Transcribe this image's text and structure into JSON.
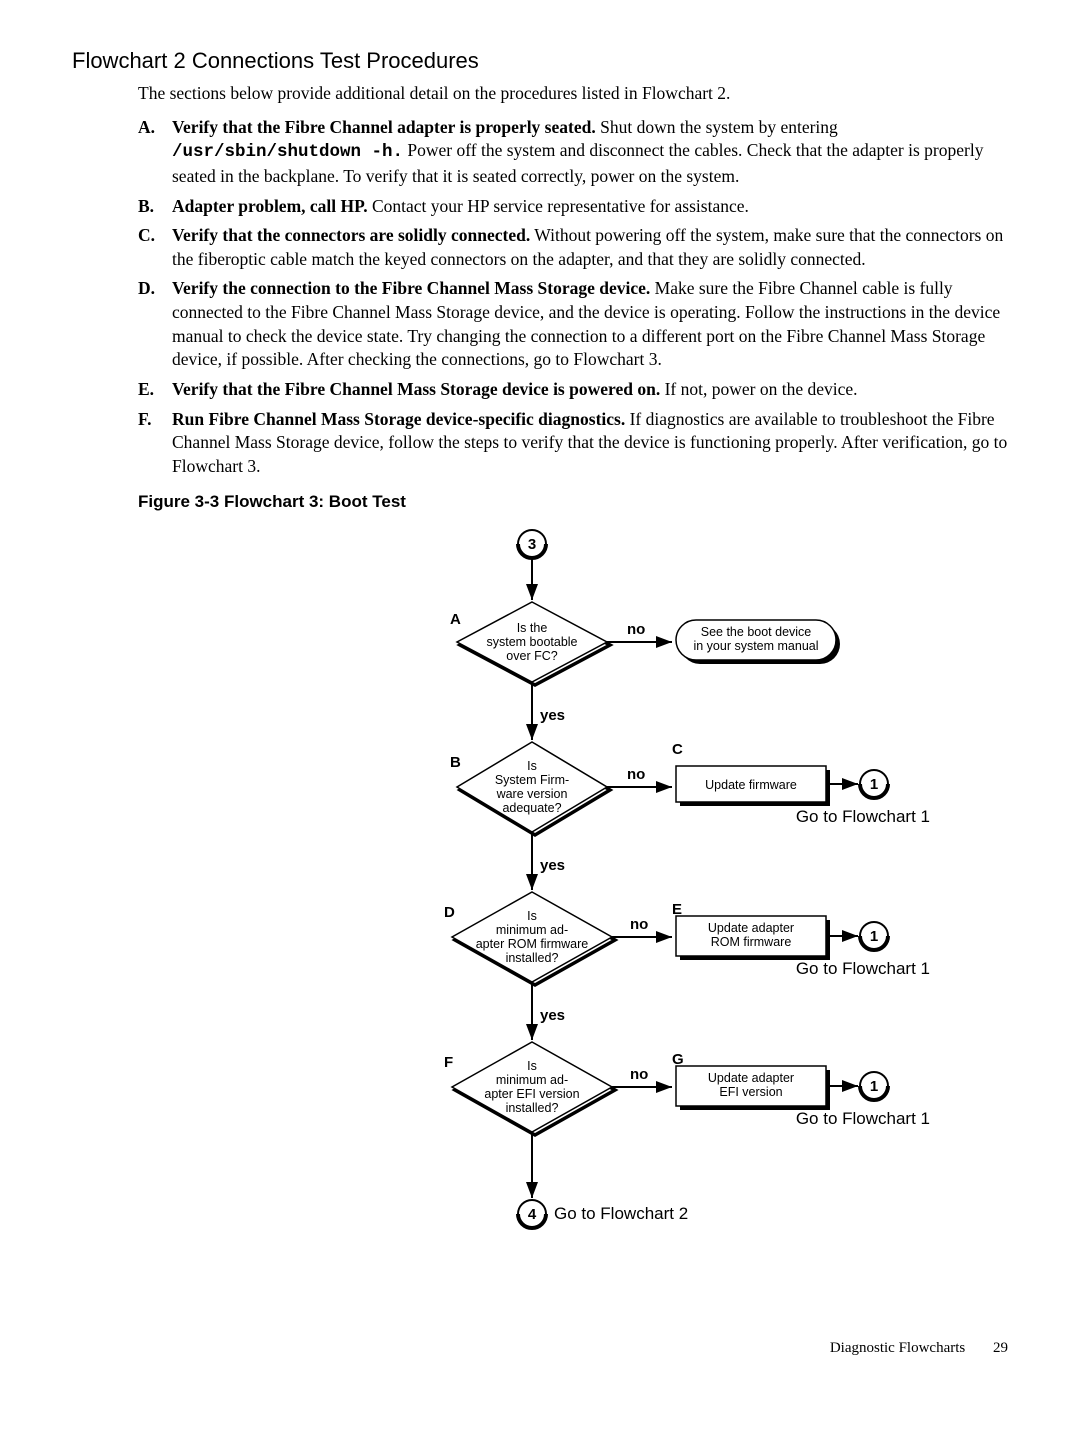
{
  "section_title": "Flowchart 2 Connections Test Procedures",
  "intro": "The sections below provide additional detail on the procedures listed in Flowchart 2.",
  "items": {
    "A": {
      "m": "A.",
      "bold": "Verify that the Fibre Channel adapter is properly seated.",
      "t1": " Shut down the system by entering ",
      "mono": "/usr/sbin/shutdown -h.",
      "t2": " Power off the system and disconnect the cables. Check that the adapter is properly seated in the backplane. To verify that it is seated correctly, power on the system."
    },
    "B": {
      "m": "B.",
      "bold": "Adapter problem, call HP.",
      "t": " Contact your HP service representative for assistance."
    },
    "C": {
      "m": "C.",
      "bold": "Verify that the connectors are solidly connected.",
      "t": " Without powering off the system, make sure that the connectors on the fiberoptic cable match the keyed connectors on the adapter, and that they are solidly connected."
    },
    "D": {
      "m": "D.",
      "bold": "Verify the connection to the Fibre Channel Mass Storage device.",
      "t": " Make sure the Fibre Channel cable is fully connected to the Fibre Channel Mass Storage device, and the device is operating. Follow the instructions in the device manual to check the device state. Try changing the connection to a different port on the Fibre Channel Mass Storage device, if possible. After checking the connections, go to Flowchart 3."
    },
    "E": {
      "m": "E.",
      "bold": "Verify that the Fibre Channel Mass Storage device is powered on.",
      "t": " If not, power on the device."
    },
    "F": {
      "m": "F.",
      "bold": "Run Fibre Channel Mass Storage device-specific diagnostics.",
      "t": " If diagnostics are available to troubleshoot the Fibre Channel Mass Storage device, follow the steps to verify that the device is functioning properly. After verification, go to Flowchart 3."
    }
  },
  "figure_caption": "Figure  3-3  Flowchart 3: Boot Test",
  "chart": {
    "start_num": "3",
    "end_num": "4",
    "end_label": "Go to Flowchart 2",
    "goto1": "Go to Flowchart 1",
    "yes": "yes",
    "no": "no",
    "nodes": {
      "A": {
        "m": "A",
        "l1": "Is the",
        "l2": "system bootable",
        "l3": "over FC?",
        "act_l1": "See the boot device",
        "act_l2": "in your system manual"
      },
      "B": {
        "m": "B",
        "l1": "Is",
        "l2": "System Firm-",
        "l3": "ware version",
        "l4": "adequate?",
        "act_m": "C",
        "act": "Update firmware",
        "conn": "1"
      },
      "D": {
        "m": "D",
        "l1": "Is",
        "l2": "minimum ad-",
        "l3": "apter ROM firmware",
        "l4": "installed?",
        "act_m": "E",
        "act_l1": "Update adapter",
        "act_l2": "ROM firmware",
        "conn": "1"
      },
      "F": {
        "m": "F",
        "l1": "Is",
        "l2": "minimum ad-",
        "l3": "apter EFI version",
        "l4": "installed?",
        "act_m": "G",
        "act_l1": "Update adapter",
        "act_l2": "EFI version",
        "conn": "1"
      }
    }
  },
  "footer": {
    "title": "Diagnostic Flowcharts",
    "page": "29"
  }
}
